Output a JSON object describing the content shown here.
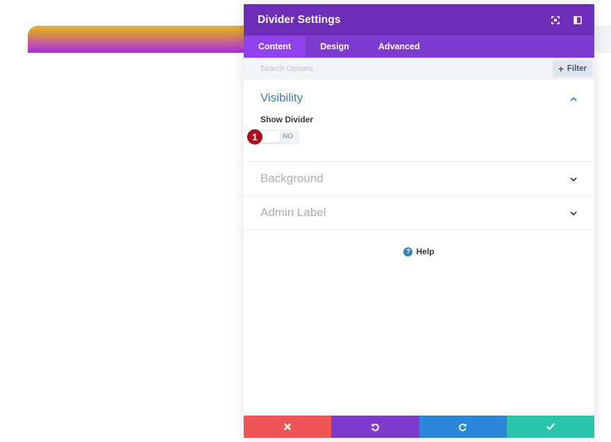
{
  "modal": {
    "title": "Divider Settings",
    "tabs": [
      {
        "label": "Content",
        "active": true
      },
      {
        "label": "Design",
        "active": false
      },
      {
        "label": "Advanced",
        "active": false
      }
    ],
    "search": {
      "placeholder": "Search Options",
      "value": ""
    },
    "filter_label": "Filter",
    "sections": {
      "visibility": {
        "title": "Visibility",
        "expanded": true,
        "field_label": "Show Divider",
        "toggle_value": "NO",
        "step_badge": "1"
      },
      "background": {
        "title": "Background",
        "expanded": false
      },
      "admin_label": {
        "title": "Admin Label",
        "expanded": false
      }
    },
    "help_label": "Help",
    "footer": [
      "cancel-icon",
      "undo-icon",
      "redo-icon",
      "save-check-icon"
    ]
  },
  "colors": {
    "header": "#6c2eb9",
    "tabs": "#7e3bd0",
    "active_tab": "#8f42ec",
    "accent_blue": "#2e82bd",
    "cancel": "#ef5555",
    "undo": "#7e3bd0",
    "redo": "#2b87da",
    "save": "#29c4a9",
    "badge": "#a8101d"
  }
}
